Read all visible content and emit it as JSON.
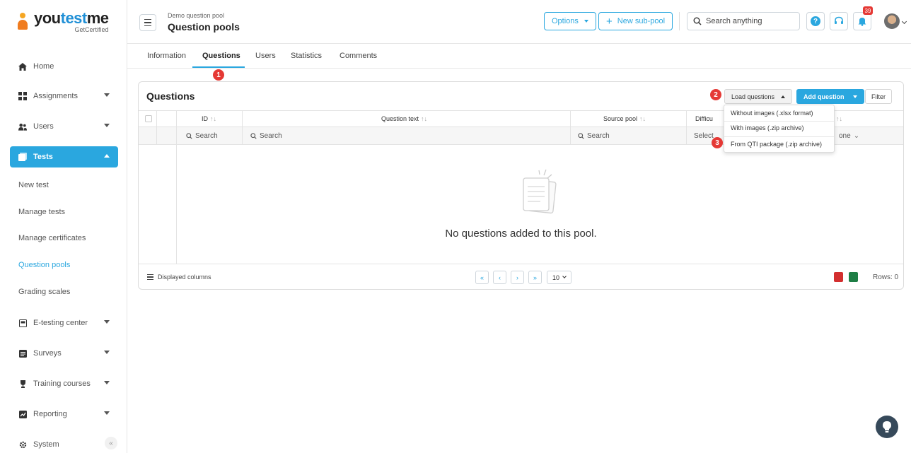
{
  "brand": {
    "name_left": "you",
    "name_accent": "test",
    "name_right": "me",
    "sub": "GetCertified"
  },
  "sidebar": {
    "items": [
      {
        "label": "Home",
        "icon": "home-icon"
      },
      {
        "label": "Assignments",
        "icon": "assignments-icon"
      },
      {
        "label": "Users",
        "icon": "users-icon"
      },
      {
        "label": "Tests",
        "icon": "tests-icon"
      },
      {
        "label": "E-testing center",
        "icon": "e-testing-icon"
      },
      {
        "label": "Surveys",
        "icon": "surveys-icon"
      },
      {
        "label": "Training courses",
        "icon": "trophy-icon"
      },
      {
        "label": "Reporting",
        "icon": "reporting-icon"
      },
      {
        "label": "System",
        "icon": "gear-icon"
      }
    ],
    "tests_sub": [
      "New test",
      "Manage tests",
      "Manage certificates",
      "Question pools",
      "Grading scales"
    ],
    "collapse_label": "«"
  },
  "header": {
    "breadcrumb": "Demo question pool",
    "title": "Question pools",
    "options_label": "Options",
    "new_subpool_label": "New sub-pool",
    "search_placeholder": "Search anything",
    "notifications_count": "39"
  },
  "tabs": [
    "Information",
    "Questions",
    "Users",
    "Statistics",
    "Comments"
  ],
  "steps": [
    "1",
    "2",
    "3"
  ],
  "panel": {
    "title": "Questions",
    "load_label": "Load questions",
    "add_label": "Add question",
    "filter_label": "Filter",
    "columns": [
      {
        "label": "ID",
        "sort": "↑↓"
      },
      {
        "label": "Question text",
        "sort": "↑↓"
      },
      {
        "label": "Source pool",
        "sort": "↑↓"
      },
      {
        "label": "Difficu"
      },
      {
        "label": "",
        "sort": "↑↓"
      }
    ],
    "search_placeholders": [
      "Search",
      "Search",
      "Search"
    ],
    "difficulty_filter": "Select",
    "last_filter": "one",
    "empty_text": "No questions added to this pool.",
    "displayed_columns": "Displayed columns",
    "pagination": {
      "first": "«",
      "prev": "‹",
      "next": "›",
      "last": "»",
      "page_size": "10"
    },
    "rows_label": "Rows: 0"
  },
  "load_menu": [
    "Without images (.xlsx format)",
    "With images (.zip archive)",
    "From QTI package (.zip archive)"
  ],
  "colors": {
    "accent": "#2aa7df",
    "step": "#e53935",
    "fab": "#36495a",
    "pdf": "#d32f2f",
    "excel": "#1e7e45"
  }
}
